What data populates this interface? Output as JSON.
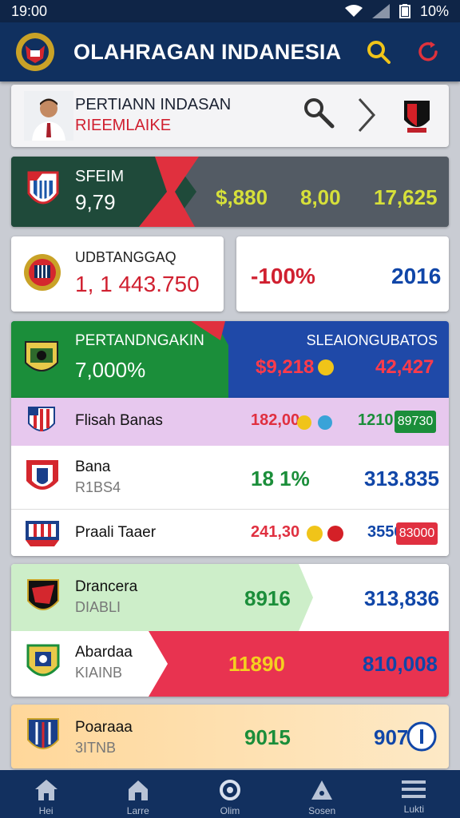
{
  "status": {
    "time": "19:00",
    "battery": "10%"
  },
  "app": {
    "title": "OLAHRAGAN INDANESIA"
  },
  "featured": {
    "title": "PERTIANN INDASAN",
    "subtitle": "RIEEMLAIKE"
  },
  "stat_bar": {
    "label": "SFEIM",
    "value": "9,79",
    "v1": "$,880",
    "v2": "8,00",
    "v3": "17,625"
  },
  "boxes": {
    "left_label": "UDBTANGGAQ",
    "left_value": "1, 1 443.750",
    "mid_value": "-100%",
    "right_value": "2016"
  },
  "section": {
    "left_title": "PERTANDNGAKIN",
    "left_value": "7,000%",
    "right_title": "SLEAIONGUBATOS",
    "right_v1": "$9,218",
    "right_v2": "42,427"
  },
  "rows": [
    {
      "name": "Flisah Banas",
      "sub": "",
      "v1": "182,00",
      "v2": "1210",
      "tag": "89730"
    },
    {
      "name": "Bana",
      "sub": "R1BS4",
      "v1": "18 1%",
      "v2": "313.835"
    },
    {
      "name": "Praali Taaer",
      "sub": "",
      "v1": "241,30",
      "v2": "3556",
      "tag": "83000"
    },
    {
      "name": "Drancera",
      "sub": "DIABLI",
      "v1": "8916",
      "v2": "313,836"
    },
    {
      "name": "Abardaa",
      "sub": "KIAINB",
      "v1": "11890",
      "v2": "810,008"
    },
    {
      "name": "Poaraaa",
      "sub": "3ITNB",
      "v1": "9015",
      "v2": "907"
    }
  ],
  "colors": {
    "green": "#1b8e3a",
    "blue": "#1046a8",
    "red": "#e03040",
    "yellow": "#c8d42a",
    "navy": "#10305f"
  },
  "nav": [
    {
      "icon": "home-icon",
      "label": "Hei"
    },
    {
      "icon": "house-icon",
      "label": "Larre"
    },
    {
      "icon": "search-icon",
      "label": "Olim"
    },
    {
      "icon": "alert-icon",
      "label": "Sosen"
    },
    {
      "icon": "menu-icon",
      "label": "Lukti"
    }
  ]
}
